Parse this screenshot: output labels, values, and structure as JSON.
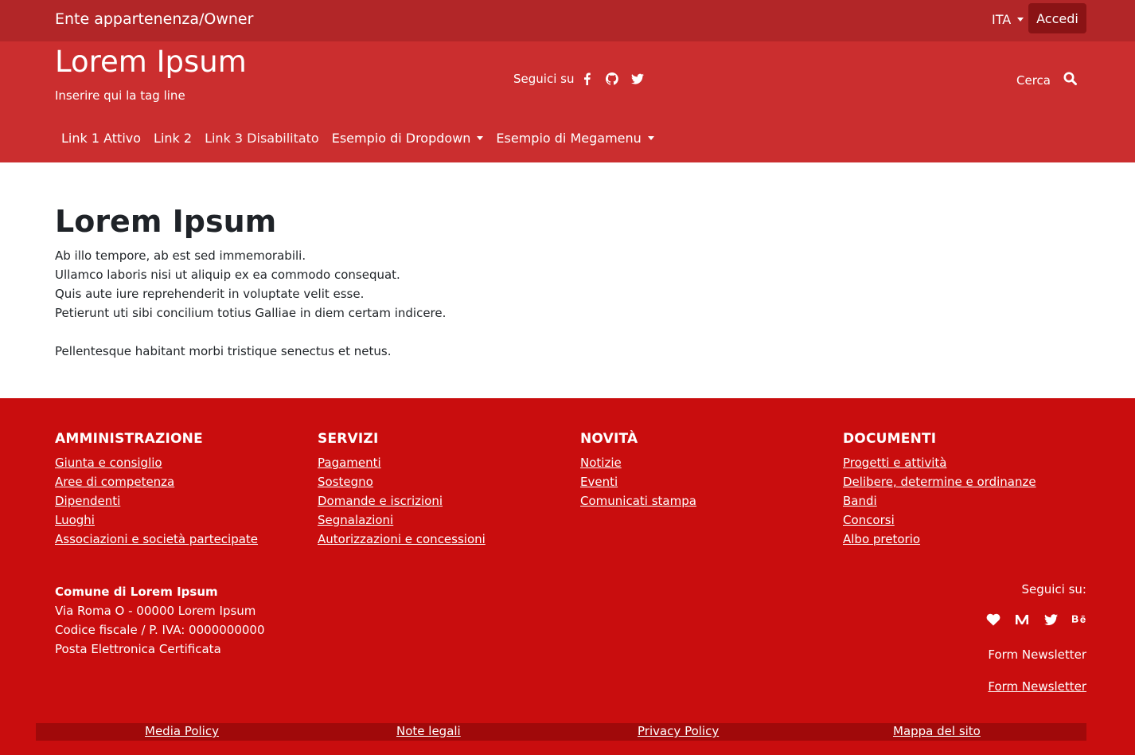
{
  "topbar": {
    "owner": "Ente appartenenza/Owner",
    "language": "ITA",
    "login": "Accedi"
  },
  "header": {
    "title": "Lorem Ipsum",
    "tagline": "Inserire qui la tag line",
    "social_label": "Seguici su",
    "social_icons": [
      "facebook-icon",
      "github-icon",
      "twitter-icon"
    ],
    "search_label": "Cerca",
    "nav": [
      {
        "label": "Link 1 Attivo"
      },
      {
        "label": "Link 2"
      },
      {
        "label": "Link 3 Disabilitato"
      },
      {
        "label": "Esempio di Dropdown"
      },
      {
        "label": "Esempio di Megamenu"
      }
    ]
  },
  "main": {
    "title": "Lorem Ipsum",
    "lines": [
      "Ab illo tempore, ab est sed immemorabili.",
      "Ullamco laboris nisi ut aliquip ex ea commodo consequat.",
      "Quis aute iure reprehenderit in voluptate velit esse.",
      "Petierunt uti sibi concilium totius Galliae in diem certam indicere."
    ],
    "extra": "Pellentesque habitant morbi tristique senectus et netus."
  },
  "footer": {
    "columns": [
      {
        "title": "AMMINISTRAZIONE",
        "links": [
          "Giunta e consiglio",
          "Aree di competenza",
          "Dipendenti",
          "Luoghi",
          "Associazioni e società partecipate"
        ]
      },
      {
        "title": "SERVIZI",
        "links": [
          "Pagamenti",
          "Sostegno",
          "Domande e iscrizioni",
          "Segnalazioni",
          "Autorizzazioni e concessioni"
        ]
      },
      {
        "title": "NOVITÀ",
        "links": [
          "Notizie",
          "Eventi",
          "Comunicati stampa"
        ]
      },
      {
        "title": "DOCUMENTI",
        "links": [
          "Progetti e attività",
          "Delibere, determine e ordinanze",
          "Bandi",
          "Concorsi",
          "Albo pretorio"
        ]
      }
    ],
    "address": {
      "name": "Comune di Lorem Ipsum",
      "street": "Via Roma O - 00000 Lorem Ipsum",
      "tax": "Codice fiscale / P. IVA: 0000000000",
      "pec": "Posta Elettronica Certificata"
    },
    "follow_label": "Seguici su:",
    "follow_icons": [
      "heart-icon",
      "medium-icon",
      "twitter-icon",
      "behance-icon"
    ],
    "newsletter_1": "Form Newsletter",
    "newsletter_2": "Form Newsletter",
    "bottom_links": [
      "Media Policy",
      "Note legali",
      "Privacy Policy",
      "Mappa del sito"
    ]
  }
}
